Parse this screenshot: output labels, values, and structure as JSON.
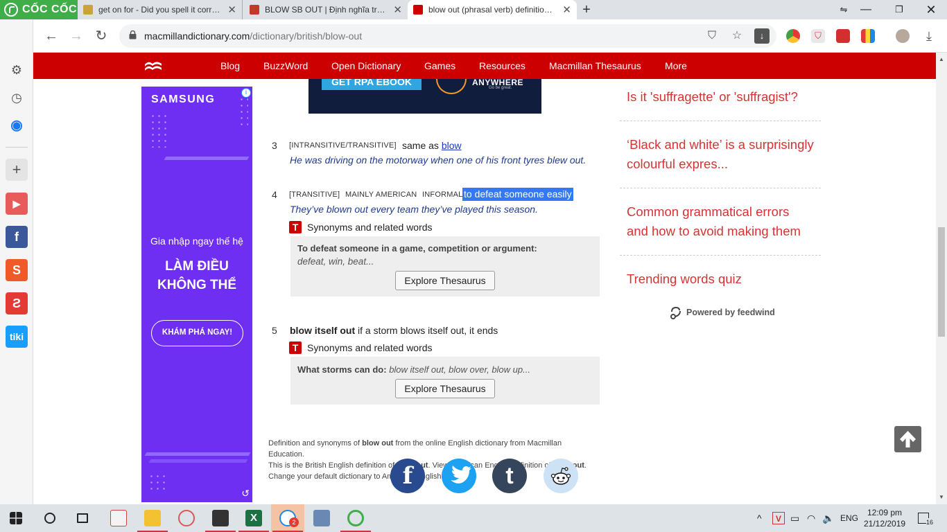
{
  "browser": {
    "brand": "CỐC CỐC",
    "tabs": [
      {
        "title": "get on for - Did you spell it correct..."
      },
      {
        "title": "BLOW SB OUT | Định nghĩa trong Từ..."
      },
      {
        "title": "blow out (phrasal verb) definition a..."
      }
    ],
    "url_host": "macmillandictionary.com",
    "url_path": "/dictionary/british/blow-out"
  },
  "site_nav": {
    "items": [
      "Blog",
      "BuzzWord",
      "Open Dictionary",
      "Games",
      "Resources",
      "Macmillan Thesaurus",
      "More"
    ]
  },
  "ad": {
    "brand": "SAMSUNG",
    "tagline1": "Gia nhập ngay thế hệ",
    "tagline2a": "LÀM ĐIỀU",
    "tagline2b": "KHÔNG THỂ",
    "cta": "KHÁM PHÁ NGAY!"
  },
  "banner": {
    "button": "GET RPA EBOOK",
    "word": "ANYWHERE",
    "slogan": "Go be great."
  },
  "senses": [
    {
      "number": "3",
      "grammar": "[INTRANSITIVE/TRANSITIVE]",
      "definition_prefix": "same as ",
      "definition_link": "blow",
      "example": "He was driving on the motorway when one of his front tyres blew out."
    },
    {
      "number": "4",
      "grammar": "[TRANSITIVE]",
      "region": "MAINLY AMERICAN",
      "style": "INFORMAL",
      "definition": "to defeat someone easily",
      "example": "They’ve blown out every team they’ve played this season.",
      "synonyms_label": "Synonyms and related words",
      "thesaurus_heading": "To defeat someone in a game, competition or argument:",
      "thesaurus_words": "defeat, win, beat...",
      "explore_label": "Explore Thesaurus"
    },
    {
      "number": "5",
      "phrase": "blow itself out",
      "definition": " if a storm blows itself out, it ends",
      "synonyms_label": "Synonyms and related words",
      "thesaurus_heading": "What storms can do:",
      "thesaurus_words": " blow itself out, blow over, blow up...",
      "explore_label": "Explore Thesaurus"
    }
  ],
  "footer": {
    "line1_a": "Definition and synonyms of ",
    "line1_b": "blow out",
    "line1_c": " from the online English dictionary from Macmillan",
    "line2": "Education.",
    "line3_a": "This is the British English definition of ",
    "line3_b": "blow out",
    "line3_c": ". View American English definition of ",
    "line3_d": "blow out",
    "line3_e": ".",
    "line4": "Change your default dictionary to American English."
  },
  "share": [
    {
      "icon": "facebook-icon",
      "glyph": "f",
      "color": "#2a4a8f"
    },
    {
      "icon": "twitter-icon",
      "glyph": "🐦",
      "color": "#1da1f2"
    },
    {
      "icon": "tumblr-icon",
      "glyph": "t",
      "color": "#35465c"
    },
    {
      "icon": "reddit-icon",
      "glyph": "👽",
      "color": "#cde3f5"
    }
  ],
  "sidebar_links": [
    "Is it 'suffragette' or 'suffragist'?",
    "‘Black and white’ is a surprisingly colourful expres...",
    "Common grammatical errors and how to avoid making them",
    "Trending words quiz"
  ],
  "feedwind": "Powered by feedwind",
  "taskbar": {
    "lang": "ENG",
    "time": "12:09 pm",
    "date": "21/12/2019",
    "notif_count": "16",
    "zalo_badge": "2"
  },
  "colors": {
    "macmillan_red": "#cc0000",
    "link_red": "#d63333",
    "highlight": "#3478f6",
    "ad_purple": "#6f2ff2"
  }
}
